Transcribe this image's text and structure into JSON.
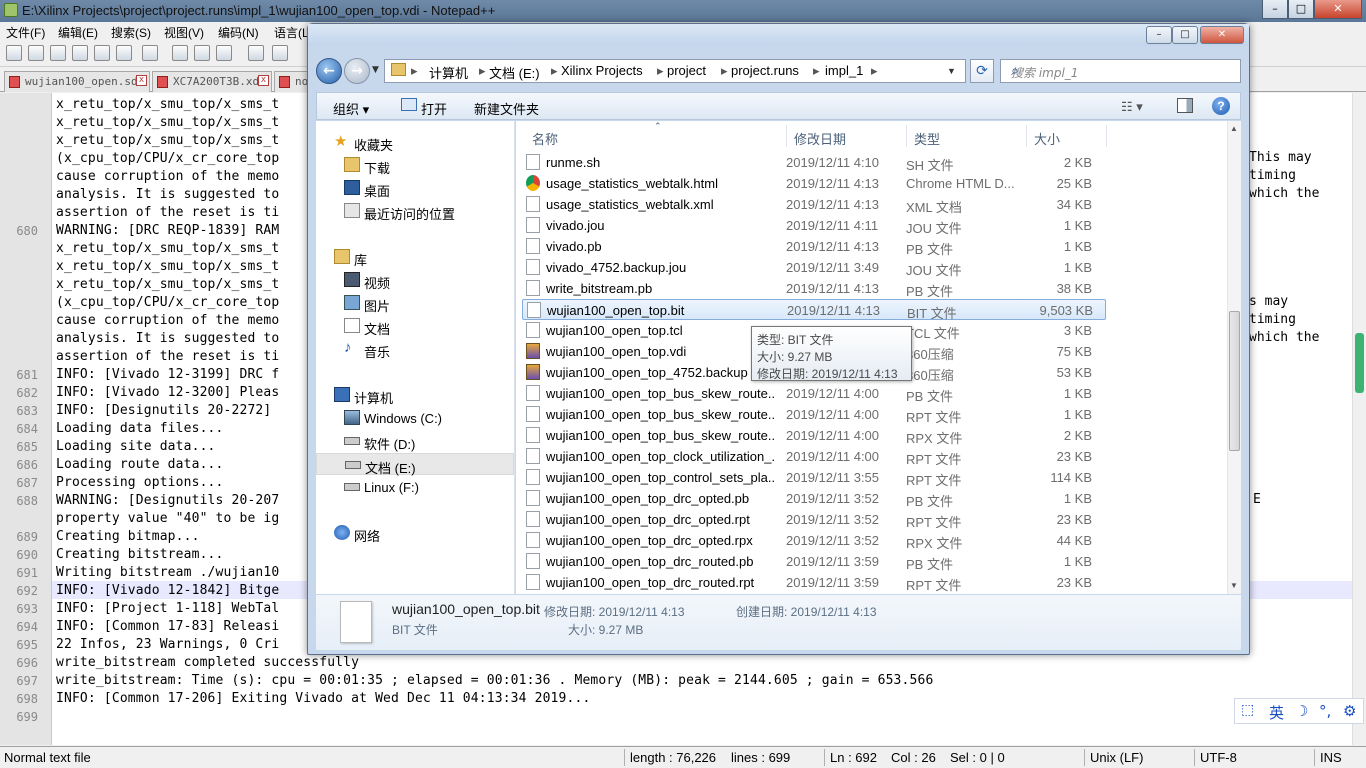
{
  "npp": {
    "title": "E:\\Xilinx Projects\\project\\project.runs\\impl_1\\wujian100_open_top.vdi - Notepad++",
    "menu": [
      "文件(F)",
      "编辑(E)",
      "搜索(S)",
      "视图(V)",
      "编码(N)",
      "语言(L"
    ],
    "tabs": [
      "wujian100_open.sdc",
      "XC7A200T3B.xdc",
      "no"
    ],
    "lines": [
      {
        "n": "",
        "t": "x_retu_top/x_smu_top/x_sms_t"
      },
      {
        "n": "",
        "t": "x_retu_top/x_smu_top/x_sms_t"
      },
      {
        "n": "",
        "t": "x_retu_top/x_smu_top/x_sms_t"
      },
      {
        "n": "",
        "t": "(x_cpu_top/CPU/x_cr_core_top"
      },
      {
        "n": "",
        "t": "cause corruption of the memo"
      },
      {
        "n": "",
        "t": "analysis. It is suggested to"
      },
      {
        "n": "",
        "t": "assertion of the reset is ti"
      },
      {
        "n": "680",
        "t": "WARNING: [DRC REQP-1839] RAM"
      },
      {
        "n": "",
        "t": "x_retu_top/x_smu_top/x_sms_t"
      },
      {
        "n": "",
        "t": "x_retu_top/x_smu_top/x_sms_t"
      },
      {
        "n": "",
        "t": "x_retu_top/x_smu_top/x_sms_t"
      },
      {
        "n": "",
        "t": "(x_cpu_top/CPU/x_cr_core_top"
      },
      {
        "n": "",
        "t": "cause corruption of the memo"
      },
      {
        "n": "",
        "t": "analysis. It is suggested to"
      },
      {
        "n": "",
        "t": "assertion of the reset is ti"
      },
      {
        "n": "681",
        "t": "INFO: [Vivado 12-3199] DRC f"
      },
      {
        "n": "682",
        "t": "INFO: [Vivado 12-3200] Pleas"
      },
      {
        "n": "683",
        "t": "INFO: [Designutils 20-2272]"
      },
      {
        "n": "684",
        "t": "Loading data files..."
      },
      {
        "n": "685",
        "t": "Loading site data..."
      },
      {
        "n": "686",
        "t": "Loading route data..."
      },
      {
        "n": "687",
        "t": "Processing options..."
      },
      {
        "n": "688",
        "t": "WARNING: [Designutils 20-207"
      },
      {
        "n": "",
        "t": "property value \"40\" to be ig"
      },
      {
        "n": "689",
        "t": "Creating bitmap..."
      },
      {
        "n": "690",
        "t": "Creating bitstream..."
      },
      {
        "n": "691",
        "t": "Writing bitstream ./wujian10"
      },
      {
        "n": "692",
        "t": "INFO: [Vivado 12-1842] Bitge"
      },
      {
        "n": "693",
        "t": "INFO: [Project 1-118] WebTal"
      },
      {
        "n": "694",
        "t": "INFO: [Common 17-83] Releasi"
      },
      {
        "n": "695",
        "t": "22 Infos, 23 Warnings, 0 Cri"
      },
      {
        "n": "696",
        "t": "write_bitstream completed successfully"
      },
      {
        "n": "697",
        "t": "write_bitstream: Time (s): cpu = 00:01:35 ; elapsed = 00:01:36 . Memory (MB): peak = 2144.605 ; gain = 653.566"
      },
      {
        "n": "698",
        "t": "INFO: [Common 17-206] Exiting Vivado at Wed Dec 11 04:13:34 2019..."
      },
      {
        "n": "699",
        "t": ""
      }
    ],
    "right_fragments": [
      "This may",
      "timing",
      "which the",
      "s may",
      "timing",
      "which the",
      "E"
    ],
    "status": {
      "file_type": "Normal text file",
      "length": "length : 76,226",
      "lines": "lines : 699",
      "ln": "Ln : 692",
      "col": "Col : 26",
      "sel": "Sel : 0 | 0",
      "eol": "Unix (LF)",
      "encoding": "UTF-8",
      "mode": "INS"
    },
    "ime": {
      "lang": "英",
      "moon": "☽",
      "punct": "°,",
      "gear": "⚙"
    }
  },
  "explorer": {
    "breadcrumb": [
      "计算机",
      "文档 (E:)",
      "Xilinx Projects",
      "project",
      "project.runs",
      "impl_1"
    ],
    "search_placeholder": "搜索 impl_1",
    "toolbar": {
      "organize": "组织 ▾",
      "open": "打开",
      "new_folder": "新建文件夹"
    },
    "nav": {
      "favorites": "收藏夹",
      "downloads": "下载",
      "desktop": "桌面",
      "recent": "最近访问的位置",
      "libraries": "库",
      "videos": "视频",
      "pictures": "图片",
      "documents": "文档",
      "music": "音乐",
      "computer": "计算机",
      "drive_c": "Windows (C:)",
      "drive_d": "软件 (D:)",
      "drive_e": "文档 (E:)",
      "drive_f": "Linux (F:)",
      "network": "网络"
    },
    "columns": {
      "name": "名称",
      "date": "修改日期",
      "type": "类型",
      "size": "大小"
    },
    "files": [
      {
        "name": "runme.sh",
        "date": "2019/12/11 4:10",
        "type": "SH 文件",
        "size": "2 KB",
        "icon": "doc"
      },
      {
        "name": "usage_statistics_webtalk.html",
        "date": "2019/12/11 4:13",
        "type": "Chrome HTML D...",
        "size": "25 KB",
        "icon": "chrome"
      },
      {
        "name": "usage_statistics_webtalk.xml",
        "date": "2019/12/11 4:13",
        "type": "XML 文档",
        "size": "34 KB",
        "icon": "doc"
      },
      {
        "name": "vivado.jou",
        "date": "2019/12/11 4:11",
        "type": "JOU 文件",
        "size": "1 KB",
        "icon": "doc"
      },
      {
        "name": "vivado.pb",
        "date": "2019/12/11 4:13",
        "type": "PB 文件",
        "size": "1 KB",
        "icon": "doc"
      },
      {
        "name": "vivado_4752.backup.jou",
        "date": "2019/12/11 3:49",
        "type": "JOU 文件",
        "size": "1 KB",
        "icon": "doc"
      },
      {
        "name": "write_bitstream.pb",
        "date": "2019/12/11 4:13",
        "type": "PB 文件",
        "size": "38 KB",
        "icon": "doc"
      },
      {
        "name": "wujian100_open_top.bit",
        "date": "2019/12/11 4:13",
        "type": "BIT 文件",
        "size": "9,503 KB",
        "icon": "doc"
      },
      {
        "name": "wujian100_open_top.tcl",
        "date": "",
        "type": "TCL 文件",
        "size": "3 KB",
        "icon": "doc"
      },
      {
        "name": "wujian100_open_top.vdi",
        "date": "",
        "type": "360压缩",
        "size": "75 KB",
        "icon": "zip"
      },
      {
        "name": "wujian100_open_top_4752.backup",
        "date": "",
        "type": "360压缩",
        "size": "53 KB",
        "icon": "zip"
      },
      {
        "name": "wujian100_open_top_bus_skew_route...",
        "date": "2019/12/11 4:00",
        "type": "PB 文件",
        "size": "1 KB",
        "icon": "doc"
      },
      {
        "name": "wujian100_open_top_bus_skew_route...",
        "date": "2019/12/11 4:00",
        "type": "RPT 文件",
        "size": "1 KB",
        "icon": "doc"
      },
      {
        "name": "wujian100_open_top_bus_skew_route...",
        "date": "2019/12/11 4:00",
        "type": "RPX 文件",
        "size": "2 KB",
        "icon": "doc"
      },
      {
        "name": "wujian100_open_top_clock_utilization_...",
        "date": "2019/12/11 4:00",
        "type": "RPT 文件",
        "size": "23 KB",
        "icon": "doc"
      },
      {
        "name": "wujian100_open_top_control_sets_pla...",
        "date": "2019/12/11 3:55",
        "type": "RPT 文件",
        "size": "114 KB",
        "icon": "doc"
      },
      {
        "name": "wujian100_open_top_drc_opted.pb",
        "date": "2019/12/11 3:52",
        "type": "PB 文件",
        "size": "1 KB",
        "icon": "doc"
      },
      {
        "name": "wujian100_open_top_drc_opted.rpt",
        "date": "2019/12/11 3:52",
        "type": "RPT 文件",
        "size": "23 KB",
        "icon": "doc"
      },
      {
        "name": "wujian100_open_top_drc_opted.rpx",
        "date": "2019/12/11 3:52",
        "type": "RPX 文件",
        "size": "44 KB",
        "icon": "doc"
      },
      {
        "name": "wujian100_open_top_drc_routed.pb",
        "date": "2019/12/11 3:59",
        "type": "PB 文件",
        "size": "1 KB",
        "icon": "doc"
      },
      {
        "name": "wujian100_open_top_drc_routed.rpt",
        "date": "2019/12/11 3:59",
        "type": "RPT 文件",
        "size": "23 KB",
        "icon": "doc"
      }
    ],
    "selected_index": 7,
    "tooltip": {
      "type": "类型: BIT 文件",
      "size": "大小: 9.27 MB",
      "date": "修改日期: 2019/12/11 4:13"
    },
    "details": {
      "name": "wujian100_open_top.bit",
      "kind": "BIT 文件",
      "modified": "修改日期: 2019/12/11 4:13",
      "created": "创建日期: 2019/12/11 4:13",
      "size": "大小: 9.27 MB"
    }
  }
}
